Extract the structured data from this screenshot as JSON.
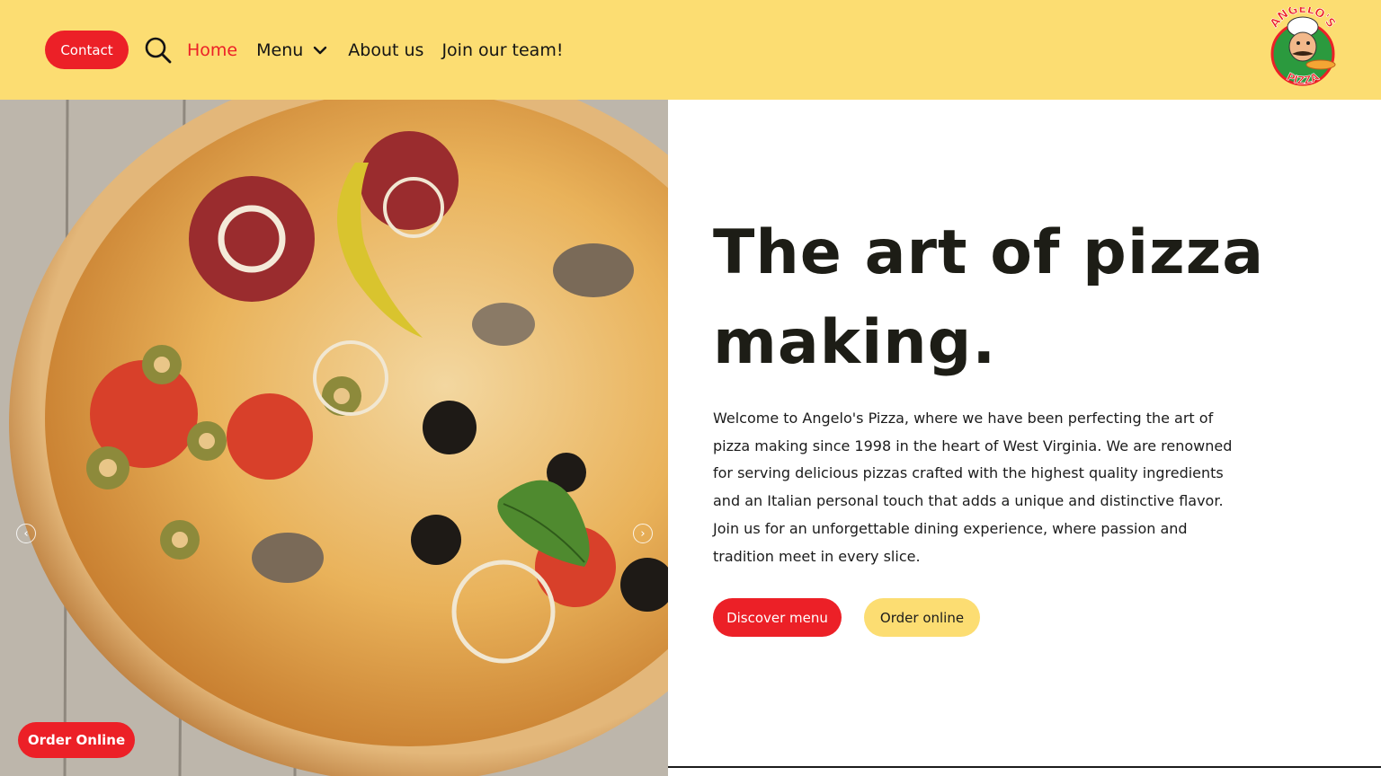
{
  "header": {
    "contact_label": "Contact",
    "nav": [
      {
        "label": "Home",
        "active": true
      },
      {
        "label": "Menu",
        "has_dropdown": true
      },
      {
        "label": "About us"
      },
      {
        "label": "Join our team!"
      }
    ],
    "logo": {
      "text_top": "ANGELO'S",
      "text_bottom": "PIZZA"
    }
  },
  "hero": {
    "title": "The art of pizza making.",
    "description": "Welcome to Angelo's Pizza, where we have been perfecting the art of pizza making since 1998 in the heart of West Virginia. We are renowned for serving delicious pizzas crafted with the highest quality ingredients and an Italian personal touch that adds a unique and distinctive flavor. Join us for an unforgettable dining experience, where passion and tradition meet in every slice.",
    "buttons": {
      "discover": "Discover menu",
      "order": "Order online"
    }
  },
  "floating": {
    "order_online": "Order Online"
  },
  "icons": {
    "search": "search-icon",
    "dropdown": "chevron-down-icon",
    "prev": "chevron-left-icon",
    "next": "chevron-right-icon"
  },
  "colors": {
    "header_bg": "#fcdd72",
    "accent_red": "#ec2027",
    "text_dark": "#1d1d16"
  }
}
